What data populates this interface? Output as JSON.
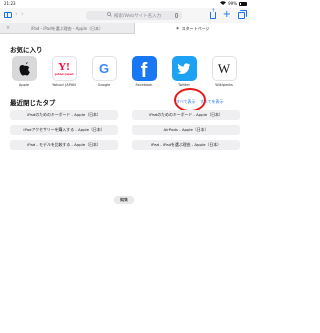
{
  "status_bar": {
    "time": "21:23",
    "wifi": "wifi-icon",
    "battery_percent": "99%"
  },
  "toolbar": {
    "search_placeholder": "検索/Webサイト名入力",
    "back": "‹",
    "forward": "›"
  },
  "tabs": [
    {
      "label": "iPad - iPadを選ぶ理由 - Apple（日本）",
      "active": false
    },
    {
      "label": "スタートページ",
      "active": true
    }
  ],
  "favorites": {
    "title": "お気に入り",
    "items": [
      {
        "label": "Apple",
        "icon": "apple-logo-icon",
        "bg": "#d9d9dc"
      },
      {
        "label": "Yahoo! JAPAN",
        "icon": "yahoo-japan-logo-icon",
        "tile_text": "Y!",
        "caption": "yahoo! japan",
        "bg": "#ffffff"
      },
      {
        "label": "Google",
        "icon": "google-logo-icon",
        "tile_text": "G",
        "bg": "#ffffff"
      },
      {
        "label": "Facebook",
        "icon": "facebook-logo-icon",
        "tile_text": "f",
        "bg": "#1877f2"
      },
      {
        "label": "Twitter",
        "icon": "twitter-logo-icon",
        "bg": "#1da1f2"
      },
      {
        "label": "Wikipedia",
        "icon": "wikipedia-logo-icon",
        "tile_text": "W",
        "bg": "#ffffff"
      }
    ]
  },
  "recent": {
    "title": "最近閉じたタブ",
    "show_all_left": "すべて表示",
    "show_all_right": "すべてを表示",
    "items": [
      "iPadのためのキーボード - Apple（日本）",
      "iPadのためのキーボード - Apple（日本）",
      "iPadアクセサリーを購入する - Apple（日本）",
      "AirPods - Apple（日本）",
      "iPad - モデルを比較する - Apple（日本）",
      "iPad - iPadを選ぶ理由 - Apple（日本）"
    ]
  },
  "edit_label": "編集",
  "colors": {
    "accent": "#1a73e8",
    "highlight_circle": "#e31b1b"
  }
}
